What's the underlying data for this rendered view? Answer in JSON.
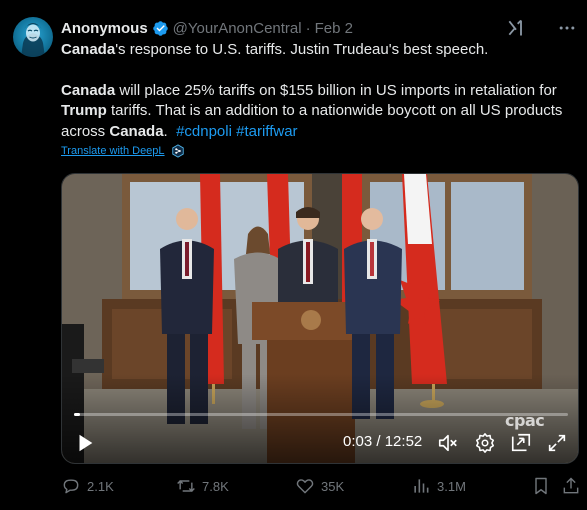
{
  "author": {
    "display_name": "Anonymous",
    "handle": "@YourAnonCentral",
    "separator": "·",
    "date": "Feb 2",
    "verified": true,
    "avatar_icon": "anonymous-mask-avatar"
  },
  "tweet": {
    "line1_bold": "Canada",
    "line1_rest": "'s response to U.S. tariffs. Justin Trudeau's best speech.",
    "p2_bold1": "Canada",
    "p2_text1": " will place 25% tariffs on $155 billion in US imports in retaliation for ",
    "p2_bold2": "Trump",
    "p2_text2": " tariffs. That is an addition to a nationwide boycott on all US products across ",
    "p2_bold3": "Canada",
    "p2_text3": ".  ",
    "hashtag1": "#cdnpoli",
    "hashtag2": "#tariffwar"
  },
  "translate": {
    "label": "Translate with DeepL",
    "icon": "deepl-icon"
  },
  "video": {
    "current_time": "0:03",
    "time_separator": " / ",
    "duration": "12:52",
    "progress_fraction": 0.004,
    "watermark": "cpac",
    "icons": [
      "play-icon",
      "mute-icon",
      "settings-icon",
      "picture-in-picture-icon",
      "fullscreen-icon"
    ]
  },
  "actions": {
    "replies": "2.1K",
    "reposts": "7.8K",
    "likes": "35K",
    "views": "3.1M"
  },
  "colors": {
    "accent": "#1d9bf0",
    "muted": "#71767b",
    "text": "#e7e9ea",
    "background": "#000000"
  }
}
